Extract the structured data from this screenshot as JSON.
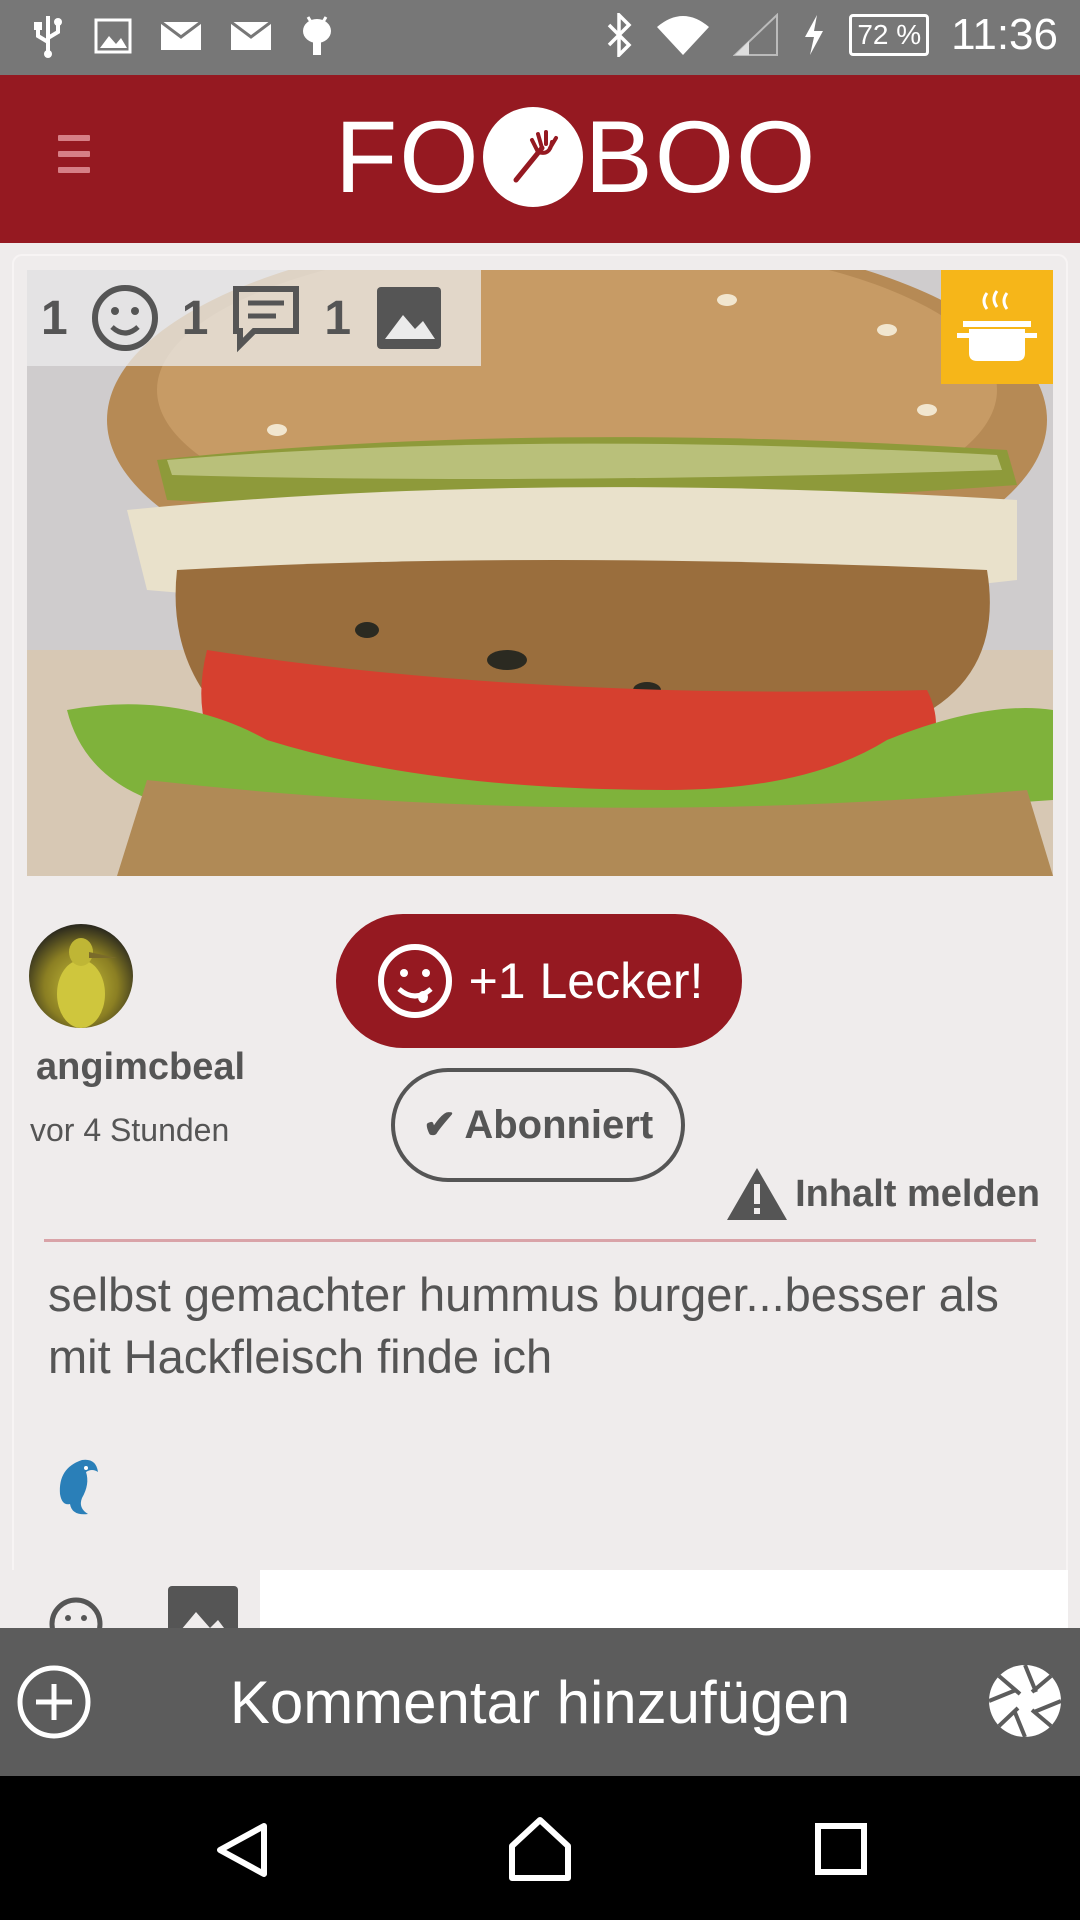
{
  "status_bar": {
    "time": "11:36",
    "battery": "72 %",
    "icons_left": [
      "usb-icon",
      "image-icon",
      "mail-icon",
      "mail-icon",
      "android-icon"
    ],
    "icons_right": [
      "bluetooth-icon",
      "wifi-icon",
      "signal-icon",
      "charging-icon"
    ]
  },
  "app_bar": {
    "logo_left": "FO",
    "logo_right": "BOO",
    "brand_color": "#951921"
  },
  "post": {
    "counters": [
      {
        "value": "1",
        "icon": "smiley-icon"
      },
      {
        "value": "1",
        "icon": "comment-icon"
      },
      {
        "value": "1",
        "icon": "photo-icon"
      }
    ],
    "category_badge_icon": "cooking-pot-icon",
    "author": "angimcbeal",
    "time_ago": "vor 4 Stunden",
    "lecker_label": "+1 Lecker!",
    "subscribe_label": "Abonniert",
    "report_label": "Inhalt melden",
    "description": "selbst gemachter hummus burger...besser als mit Hackfleisch finde ich",
    "emoji_icon": "dolphin-emoji"
  },
  "comment_bar": {
    "placeholder": "Kommentar hinzufügen",
    "add_icon": "add-circle-icon",
    "camera_icon": "camera-shutter-icon"
  },
  "nav_bar": {
    "buttons": [
      "back-icon",
      "home-icon",
      "recents-icon"
    ]
  }
}
